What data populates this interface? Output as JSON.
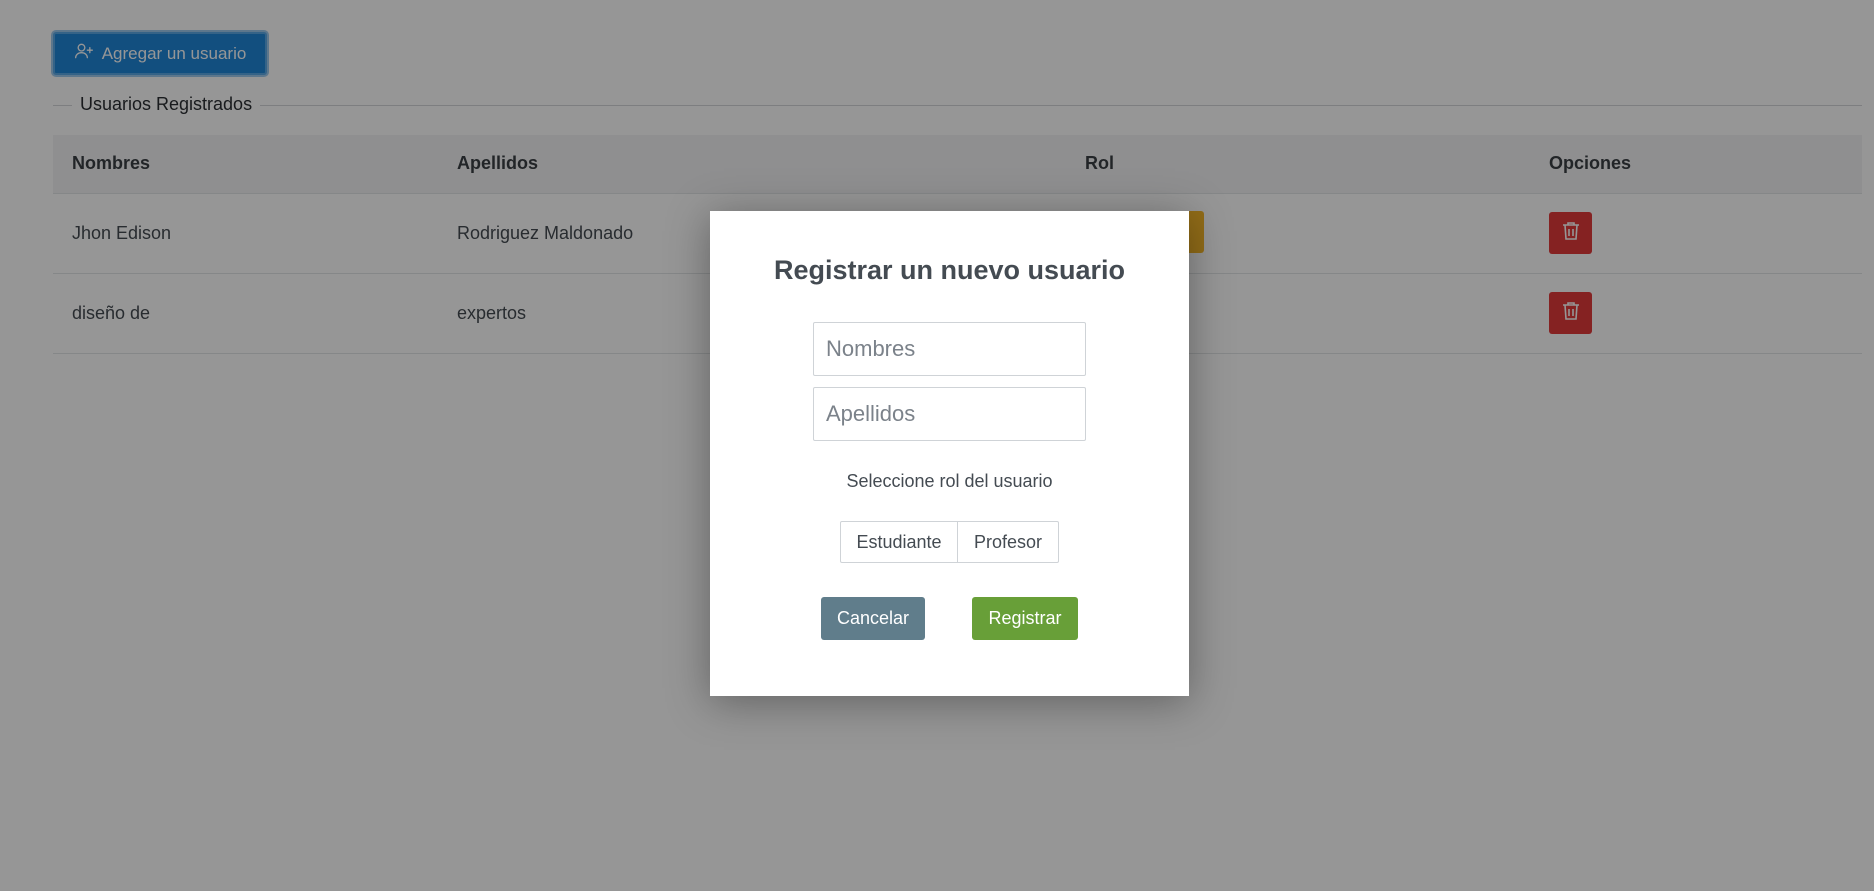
{
  "toolbar": {
    "add_user_label": "Agregar un usuario",
    "add_user_icon": "user-plus-icon"
  },
  "section": {
    "legend": "Usuarios Registrados"
  },
  "table": {
    "columns": [
      "Nombres",
      "Apellidos",
      "Rol",
      "Opciones"
    ],
    "rows": [
      {
        "nombres": "Jhon Edison",
        "apellidos": "Rodriguez Maldonado",
        "rol": "",
        "option_icon": "trash-icon"
      },
      {
        "nombres": "diseño de",
        "apellidos": "expertos",
        "rol": "",
        "option_icon": "trash-icon"
      }
    ]
  },
  "modal": {
    "title": "Registrar un nuevo usuario",
    "nombres_placeholder": "Nombres",
    "apellidos_placeholder": "Apellidos",
    "role_prompt": "Seleccione rol del usuario",
    "roles": [
      "Estudiante",
      "Profesor"
    ],
    "cancel_label": "Cancelar",
    "submit_label": "Registrar"
  },
  "colors": {
    "primary": "#1f86d8",
    "danger": "#e23a3a",
    "warning": "#f6b82a",
    "cancel": "#607d8b",
    "success": "#689f38"
  }
}
